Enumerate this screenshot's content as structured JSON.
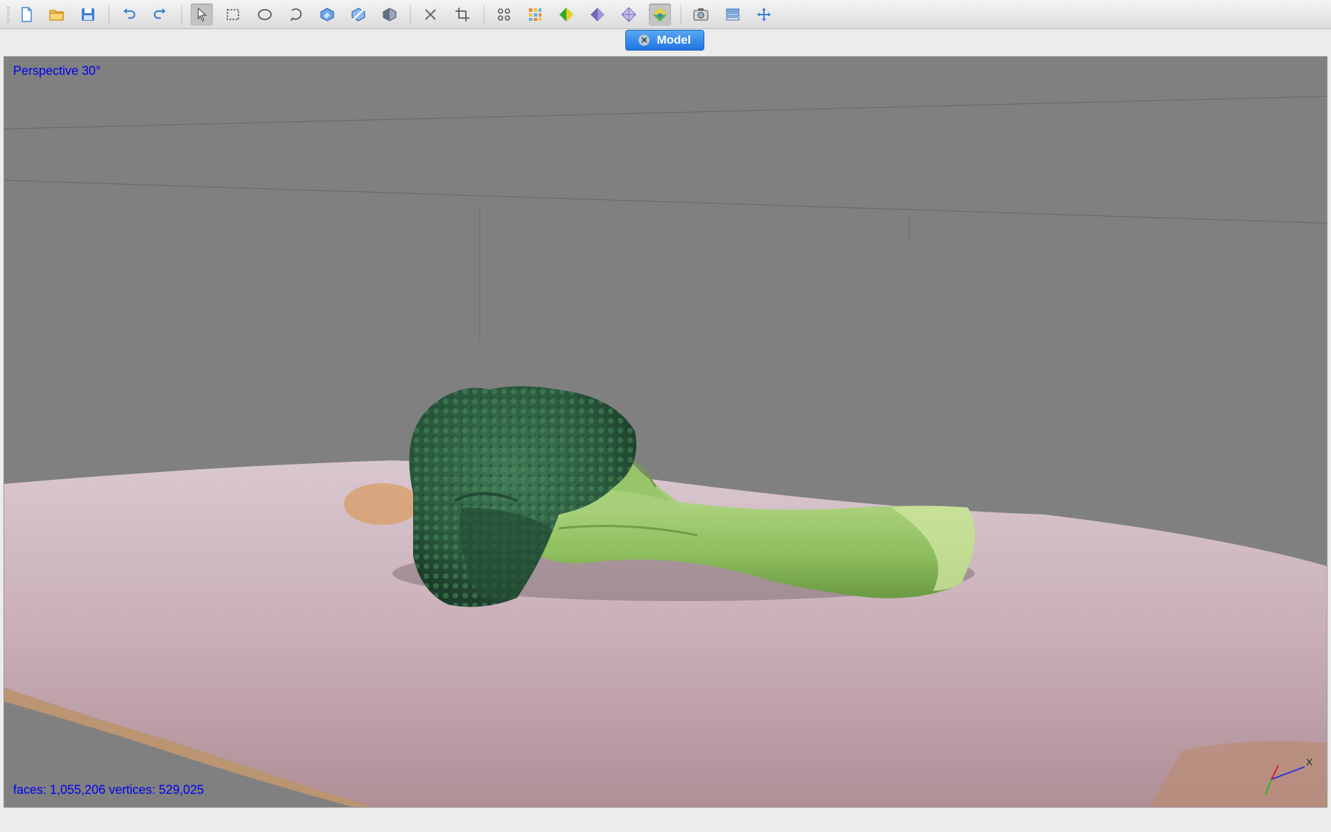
{
  "toolbar": {
    "buttons": [
      {
        "name": "new-file",
        "icon": "new-file-icon"
      },
      {
        "name": "open-folder",
        "icon": "open-folder-icon"
      },
      {
        "name": "save",
        "icon": "save-icon"
      },
      {
        "name": "undo",
        "icon": "undo-icon"
      },
      {
        "name": "redo",
        "icon": "redo-icon"
      },
      {
        "name": "select-pointer",
        "icon": "pointer-icon",
        "active": true
      },
      {
        "name": "rectangle-select",
        "icon": "rectangle-select-icon"
      },
      {
        "name": "ellipse-select",
        "icon": "ellipse-select-icon"
      },
      {
        "name": "lasso-select",
        "icon": "lasso-select-icon"
      },
      {
        "name": "brush-select",
        "icon": "brush-select-icon"
      },
      {
        "name": "brush-deselect",
        "icon": "brush-deselect-icon"
      },
      {
        "name": "invert-select",
        "icon": "invert-select-icon"
      },
      {
        "name": "delete",
        "icon": "delete-icon"
      },
      {
        "name": "crop",
        "icon": "crop-icon"
      },
      {
        "name": "points-view",
        "icon": "points-view-icon"
      },
      {
        "name": "grid-view",
        "icon": "grid-view-icon"
      },
      {
        "name": "solid-view",
        "icon": "solid-shape-icon"
      },
      {
        "name": "flat-view",
        "icon": "flat-shape-icon"
      },
      {
        "name": "wireframe-view",
        "icon": "wireframe-shape-icon"
      },
      {
        "name": "texture-view",
        "icon": "texture-shape-icon",
        "active": true
      },
      {
        "name": "snapshot",
        "icon": "camera-icon"
      },
      {
        "name": "layers",
        "icon": "layers-icon"
      },
      {
        "name": "move",
        "icon": "move-arrows-icon"
      }
    ]
  },
  "tabs": [
    {
      "label": "Model",
      "close_icon": "close-icon",
      "active": true
    }
  ],
  "viewport": {
    "projection_label": "Perspective 30°",
    "stats_label": "faces: 1,055,206 vertices: 529,025",
    "axis_label_x": "X"
  },
  "colors": {
    "overlay_text": "#0000ee",
    "viewport_bg": "#808080",
    "tab_active": "#2a7fe6"
  }
}
